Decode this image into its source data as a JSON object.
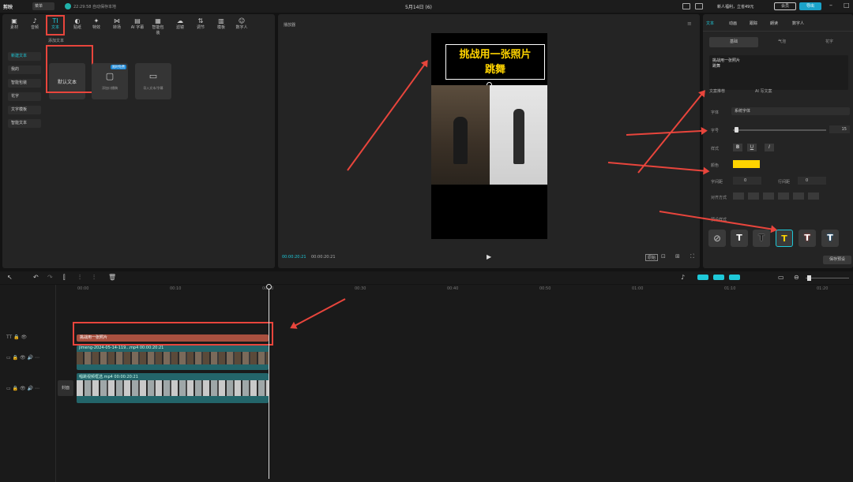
{
  "topbar": {
    "logo": "剪映",
    "menu": "菜单",
    "autosave": "22:29:58 自动保存本地",
    "project_title": "5月14日 (6)",
    "promo": "新人福利，立省49元",
    "vip": "会员",
    "export": "导出"
  },
  "toolbar": [
    {
      "label": "素材",
      "icon": "media-icon"
    },
    {
      "label": "音频",
      "icon": "audio-icon"
    },
    {
      "label": "文本",
      "icon": "text-icon"
    },
    {
      "label": "贴纸",
      "icon": "sticker-icon"
    },
    {
      "label": "特效",
      "icon": "effects-icon"
    },
    {
      "label": "转场",
      "icon": "transition-icon"
    },
    {
      "label": "AI 字幕",
      "icon": "subtitle-icon"
    },
    {
      "label": "智能包装",
      "icon": "package-icon"
    },
    {
      "label": "滤镜",
      "icon": "filter-icon"
    },
    {
      "label": "调节",
      "icon": "adjust-icon"
    },
    {
      "label": "模板",
      "icon": "template-icon"
    },
    {
      "label": "数字人",
      "icon": "avatar-icon"
    }
  ],
  "sidebar": [
    "新建文本",
    "我的",
    "智能包装",
    "花字",
    "文字模板",
    "智能文本"
  ],
  "add_text": {
    "heading": "添加文本",
    "default": "默认文本",
    "ai_writing": "添加口播稿",
    "ai_badge": "限时免费",
    "import": "导入文本/字幕"
  },
  "player": {
    "title": "播放器",
    "overlay_line1": "挑战用一张照片",
    "overlay_line2": "跳舞",
    "time_current": "00:00:20:21",
    "time_total": "00:00:20:21",
    "ratio": "原始"
  },
  "inspector": {
    "tabs": [
      "文本",
      "动画",
      "跟踪",
      "朗读",
      "数字人"
    ],
    "subtabs": [
      "基础",
      "气泡",
      "花字"
    ],
    "text_content": "挑战用一张照片\n跳舞",
    "text_extract": "文案推荐",
    "ai_write": "AI 写文案",
    "font_label": "字体",
    "font_value": "系统字体",
    "size_label": "字号",
    "size_value": "15",
    "style_label": "样式",
    "bold": "B",
    "underline": "U",
    "italic": "I",
    "color_label": "颜色",
    "text_color": "#ffd400",
    "spacing_label": "字间距",
    "spacing_value": "0",
    "line_label": "行间距",
    "line_value": "0",
    "align_label": "对齐方式",
    "preset_label": "预设样式",
    "save_preset": "保存预设"
  },
  "timeline": {
    "ticks": [
      "00:00",
      "00:10",
      "00:20",
      "00:30",
      "00:40",
      "00:50",
      "01:00",
      "01:10",
      "01:20"
    ],
    "text_clip": "挑战用一张照片",
    "video1": "jimeng-2024-05-14-119...mp4  00:00:20:21",
    "video2": "唱跳视频框选.mp4  00:00:20:21",
    "cover": "封面"
  }
}
